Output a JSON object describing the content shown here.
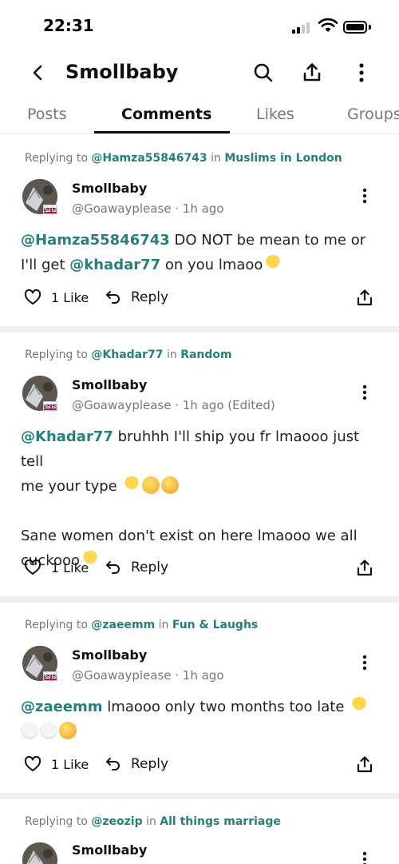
{
  "status_bar": {
    "time": "22:31"
  },
  "header": {
    "title": "Smollbaby"
  },
  "tabs": [
    {
      "label": "Posts"
    },
    {
      "label": "Comments"
    },
    {
      "label": "Likes"
    },
    {
      "label": "Groups"
    }
  ],
  "comments": [
    {
      "reply_prefix": "Replying to ",
      "reply_user": "@Hamza55846743",
      "reply_in": " in ",
      "reply_group": "Muslims in London",
      "author": "Smollbaby",
      "meta": "@Goawayplease · 1h ago",
      "line1_mention": "@Hamza55846743",
      "line1_text": " DO NOT be mean to me or",
      "line2_text": "I'll get ",
      "line2_mention": "@khadar77",
      "line2_tail": " on you lmaoo",
      "likes": "1 Like",
      "reply_label": "Reply"
    },
    {
      "reply_prefix": "Replying to ",
      "reply_user": "@Khadar77",
      "reply_in": " in ",
      "reply_group": "Random",
      "author": "Smollbaby",
      "meta": "@Goawayplease · 1h ago (Edited)",
      "line1_mention": "@Khadar77",
      "line1_text": " bruhhh I'll ship you fr lmaooo just tell",
      "line2_text": "me your type",
      "line3_text": "Sane women don't exist on here lmaooo we all",
      "line4_text": "cuckooo",
      "likes": "1 Like",
      "reply_label": "Reply"
    },
    {
      "reply_prefix": "Replying to ",
      "reply_user": "@zaeemm",
      "reply_in": " in ",
      "reply_group": "Fun & Laughs",
      "author": "Smollbaby",
      "meta": "@Goawayplease · 1h ago",
      "line1_mention": "@zaeemm",
      "line1_text": " lmaooo only two months too late",
      "likes": "1 Like",
      "reply_label": "Reply"
    },
    {
      "reply_prefix": "Replying to ",
      "reply_user": "@zeozip",
      "reply_in": " in ",
      "reply_group": "All things marriage",
      "author": "Smollbaby"
    }
  ],
  "icons": {
    "back": "chevron-left-icon",
    "search": "search-icon",
    "share": "share-icon",
    "more": "more-vertical-icon",
    "like": "heart-icon",
    "reply": "reply-arrow-icon",
    "emoji_chick": "hatching-chick-emoji",
    "emoji_smile": "smiling-face-emoji",
    "emoji_kiss": "kissing-face-emoji",
    "emoji_skull": "skull-emoji",
    "emoji_crying": "crying-face-emoji"
  },
  "colors": {
    "accent": "#23807c",
    "text": "#111111",
    "muted": "#777777",
    "divider": "#eeeeee"
  }
}
